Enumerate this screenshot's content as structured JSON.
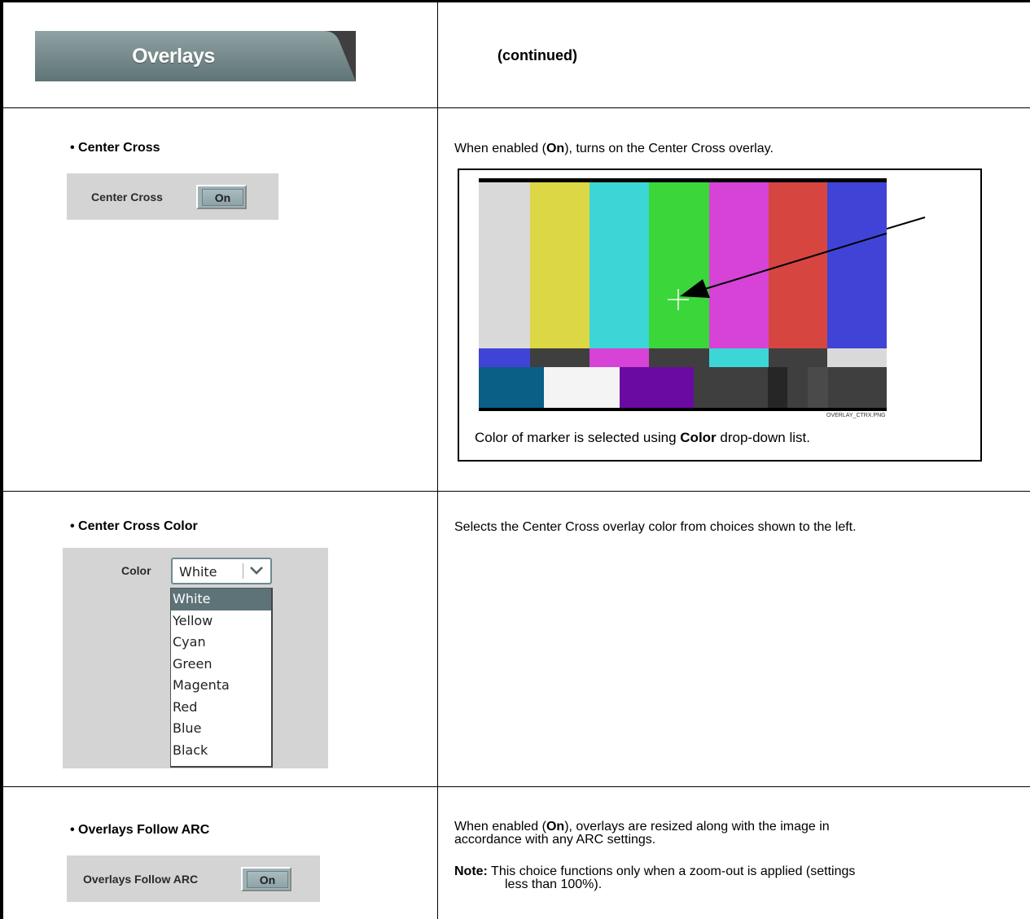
{
  "header": {
    "tab_label": "Overlays",
    "continued": "(continued)"
  },
  "rows": [
    {
      "title": "• Center Cross",
      "control_label": "Center Cross",
      "toggle_value": "On",
      "description_parts": [
        "When enabled (",
        "On",
        "), turns on the Center Cross overlay."
      ],
      "figure": {
        "filename": "OVERLAY_CTRX.PNG",
        "caption_parts": [
          "Color of marker is selected using ",
          "Color",
          " drop-down list."
        ]
      }
    },
    {
      "title": "• Center Cross Color",
      "control_label": "Color",
      "selected_value": "White",
      "options": [
        "White",
        "Yellow",
        "Cyan",
        "Green",
        "Magenta",
        "Red",
        "Blue",
        "Black"
      ],
      "description": "Selects the Center Cross overlay color from choices shown to the left."
    },
    {
      "title": "• Overlays Follow ARC",
      "control_label": "Overlays Follow ARC",
      "toggle_value": "On",
      "description_parts": [
        "When enabled (",
        "On",
        "), overlays are resized along with the image in",
        "accordance with any ARC settings."
      ],
      "note_label": "Note:",
      "note_lines": [
        "This choice functions only when a zoom-out is applied (settings",
        "less than 100%)."
      ]
    }
  ],
  "colors": {
    "tab_fill": "#6f8587",
    "toggle_fill": "#9fb3b6",
    "panel_bg": "#d4d4d4",
    "bar_white": "#d9d9d9",
    "bar_yellow": "#dcd744",
    "bar_cyan": "#3dd6d6",
    "bar_green": "#3ad63a",
    "bar_magenta": "#d643d6",
    "bar_red": "#d64540",
    "bar_blue": "#4044d6"
  }
}
